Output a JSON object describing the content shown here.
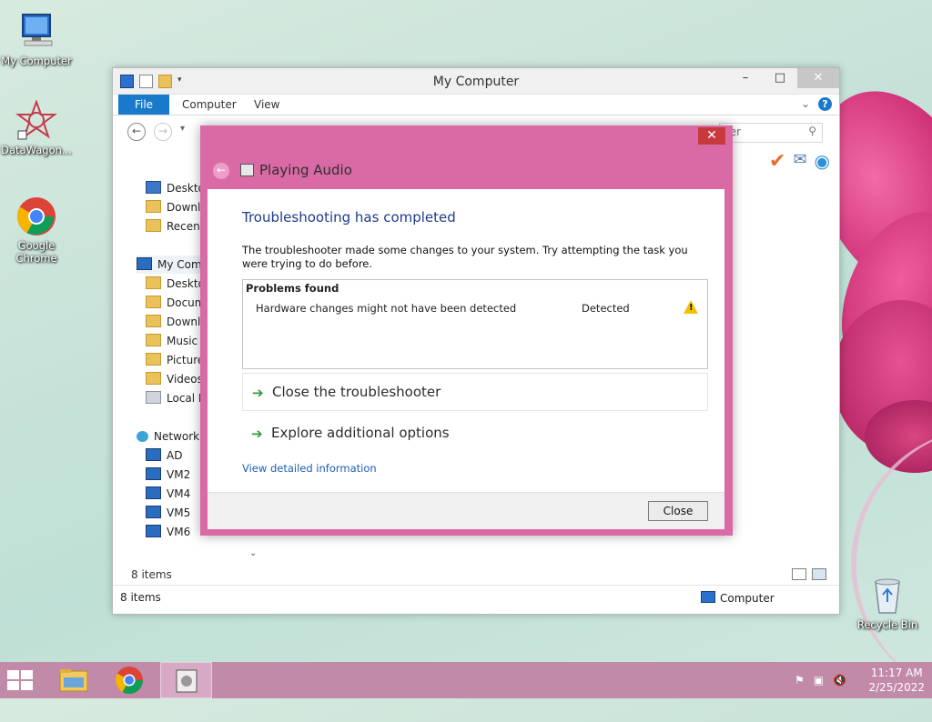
{
  "desktop": {
    "icons": [
      {
        "label": "My Computer",
        "icon": "computer-icon"
      },
      {
        "label": "DataWagon...",
        "icon": "datawagon-icon"
      },
      {
        "label": "Google Chrome",
        "icon": "chrome-icon"
      },
      {
        "label": "Recycle Bin",
        "icon": "recycle-bin-icon"
      }
    ]
  },
  "explorer": {
    "title": "My Computer",
    "ribbon": {
      "file": "File",
      "computer": "Computer",
      "view": "View",
      "help": "?"
    },
    "search_placeholder": "ter",
    "nav": {
      "favorites": [
        "Desktop",
        "Downloads",
        "Recent"
      ],
      "computer": "My Computer",
      "computer_items": [
        "Desktop",
        "Documents",
        "Downloads",
        "Music",
        "Pictures",
        "Videos",
        "Local Disk"
      ],
      "network": "Network",
      "network_items": [
        "AD",
        "VM2",
        "VM4",
        "VM5",
        "VM6"
      ]
    },
    "item_count_inner": "8 items",
    "status_left": "8 items",
    "status_right": "Computer"
  },
  "dialog": {
    "title": "Playing Audio",
    "heading": "Troubleshooting has completed",
    "description": "The troubleshooter made some changes to your system. Try attempting the task you were trying to do before.",
    "problems_header": "Problems found",
    "problem": {
      "text": "Hardware changes might not have been detected",
      "status": "Detected"
    },
    "actions": [
      "Close the troubleshooter",
      "Explore additional options"
    ],
    "detail_link": "View detailed information",
    "close_button": "Close"
  },
  "taskbar": {
    "time": "11:17 AM",
    "date": "2/25/2022"
  },
  "colors": {
    "dialog_frame": "#d96aa5",
    "taskbar": "#c28aa9",
    "ribbon_file": "#1979ca",
    "heading": "#1e3b8b",
    "link": "#1e5fb3"
  }
}
